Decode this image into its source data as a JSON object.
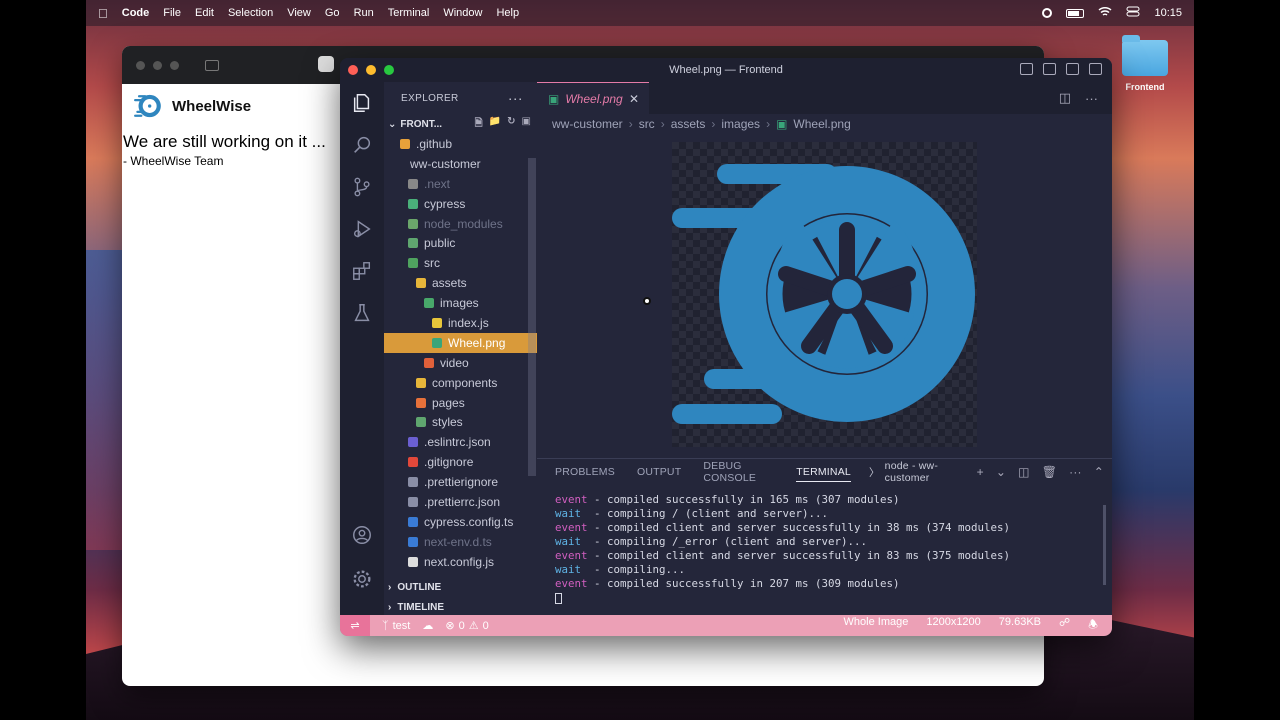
{
  "menubar": {
    "app": "Code",
    "items": [
      "File",
      "Edit",
      "Selection",
      "View",
      "Go",
      "Run",
      "Terminal",
      "Window",
      "Help"
    ],
    "clock": "10:15"
  },
  "desktop": {
    "folder_label": "Frontend"
  },
  "browser": {
    "site_name": "WheelWise",
    "message": "We are still working on it ...",
    "signature": "- WheelWise Team"
  },
  "vscode": {
    "title": "Wheel.png — Frontend",
    "explorer_label": "EXPLORER",
    "workspace_label": "FRONT...",
    "tree": [
      {
        "label": ".github",
        "indent": 0,
        "icon_color": "#e7a13a",
        "dim": false
      },
      {
        "label": "ww-customer",
        "indent": 0,
        "icon_color": "",
        "dim": false
      },
      {
        "label": ".next",
        "indent": 1,
        "icon_color": "#888",
        "dim": true
      },
      {
        "label": "cypress",
        "indent": 1,
        "icon_color": "#4ab07a",
        "dim": false
      },
      {
        "label": "node_modules",
        "indent": 1,
        "icon_color": "#6ba66b",
        "dim": true
      },
      {
        "label": "public",
        "indent": 1,
        "icon_color": "#5fa66f",
        "dim": false
      },
      {
        "label": "src",
        "indent": 1,
        "icon_color": "#4fa35f",
        "dim": false
      },
      {
        "label": "assets",
        "indent": 2,
        "icon_color": "#e7b63a",
        "dim": false
      },
      {
        "label": "images",
        "indent": 3,
        "icon_color": "#48a86a",
        "dim": false
      },
      {
        "label": "index.js",
        "indent": 4,
        "icon_color": "#e8c63a",
        "dim": false
      },
      {
        "label": "Wheel.png",
        "indent": 4,
        "icon_color": "#39a57a",
        "dim": false,
        "selected": true
      },
      {
        "label": "video",
        "indent": 3,
        "icon_color": "#e0603a",
        "dim": false
      },
      {
        "label": "components",
        "indent": 2,
        "icon_color": "#e7b63a",
        "dim": false
      },
      {
        "label": "pages",
        "indent": 2,
        "icon_color": "#e7713a",
        "dim": false
      },
      {
        "label": "styles",
        "indent": 2,
        "icon_color": "#5fa66f",
        "dim": false
      },
      {
        "label": ".eslintrc.json",
        "indent": 1,
        "icon_color": "#6b5fd1",
        "dim": false
      },
      {
        "label": ".gitignore",
        "indent": 1,
        "icon_color": "#e2483a",
        "dim": false
      },
      {
        "label": ".prettierignore",
        "indent": 1,
        "icon_color": "#8a8ea6",
        "dim": false
      },
      {
        "label": ".prettierrc.json",
        "indent": 1,
        "icon_color": "#8a8ea6",
        "dim": false
      },
      {
        "label": "cypress.config.ts",
        "indent": 1,
        "icon_color": "#3a7bd5",
        "dim": false
      },
      {
        "label": "next-env.d.ts",
        "indent": 1,
        "icon_color": "#3a7bd5",
        "dim": true
      },
      {
        "label": "next.config.js",
        "indent": 1,
        "icon_color": "#dddddd",
        "dim": false
      }
    ],
    "outline_label": "OUTLINE",
    "timeline_label": "TIMELINE",
    "tab_label": "Wheel.png",
    "breadcrumbs": [
      "ww-customer",
      "src",
      "assets",
      "images",
      "Wheel.png"
    ],
    "panel_tabs": [
      "PROBLEMS",
      "OUTPUT",
      "DEBUG CONSOLE",
      "TERMINAL"
    ],
    "terminal_name": "node - ww-customer",
    "terminal_lines": [
      {
        "kind": "event",
        "text": " - compiled successfully in 165 ms (307 modules)"
      },
      {
        "kind": "wait",
        "text": "  - compiling / (client and server)..."
      },
      {
        "kind": "event",
        "text": " - compiled client and server successfully in 38 ms (374 modules)"
      },
      {
        "kind": "wait",
        "text": "  - compiling /_error (client and server)..."
      },
      {
        "kind": "event",
        "text": " - compiled client and server successfully in 83 ms (375 modules)"
      },
      {
        "kind": "wait",
        "text": "  - compiling..."
      },
      {
        "kind": "event",
        "text": " - compiled successfully in 207 ms (309 modules)"
      }
    ],
    "status": {
      "branch": "test",
      "errors": "0",
      "warnings": "0",
      "zoom": "Whole Image",
      "dimensions": "1200x1200",
      "size": "79.63KB"
    }
  },
  "colors": {
    "logo_blue": "#2f86bf",
    "status_bar": "#eca0b6",
    "selection": "#d99a3a"
  }
}
